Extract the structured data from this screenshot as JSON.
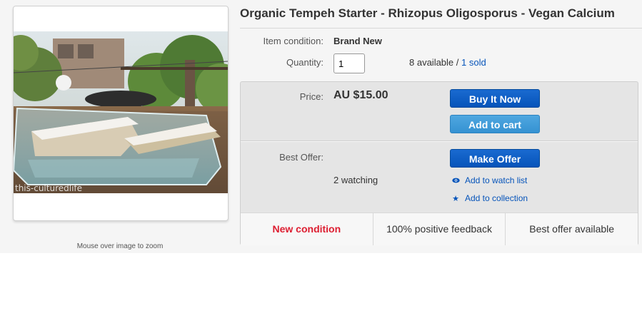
{
  "listing": {
    "title": "Organic Tempeh Starter - Rhizopus Oligosporus - Vegan Calcium",
    "zoom_hint": "Mouse over image to zoom",
    "image_watermark": "this-culturedlife"
  },
  "details": {
    "condition_label": "Item condition:",
    "condition_value": "Brand New",
    "quantity_label": "Quantity:",
    "quantity_value": "1",
    "available_text": "8 available / ",
    "sold_text": "1 sold"
  },
  "purchase": {
    "price_label": "Price:",
    "price_value": "AU $15.00",
    "buy_now_label": "Buy It Now",
    "add_to_cart_label": "Add to cart",
    "best_offer_label": "Best Offer:",
    "make_offer_label": "Make Offer",
    "watching_text": "2 watching",
    "watch_list_label": "Add to watch list",
    "collection_label": "Add to collection"
  },
  "badges": [
    "New condition",
    "100% positive feedback",
    "Best offer available"
  ],
  "colors": {
    "accent": "#0654ba",
    "button_light": "#3592d2",
    "badge_red": "#dd1e31"
  }
}
